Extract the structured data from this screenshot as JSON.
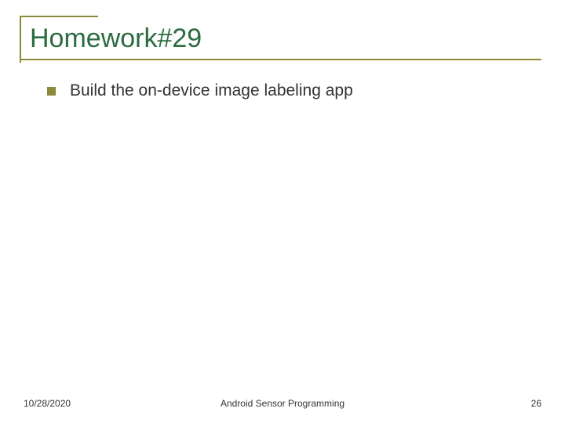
{
  "slide": {
    "title": "Homework#29",
    "bullets": [
      {
        "text": "Build the on-device image labeling app"
      }
    ]
  },
  "footer": {
    "date": "10/28/2020",
    "center": "Android Sensor Programming",
    "pageNumber": "26"
  },
  "colors": {
    "titleColor": "#2a6b3f",
    "accentColor": "#8a8a3a"
  }
}
